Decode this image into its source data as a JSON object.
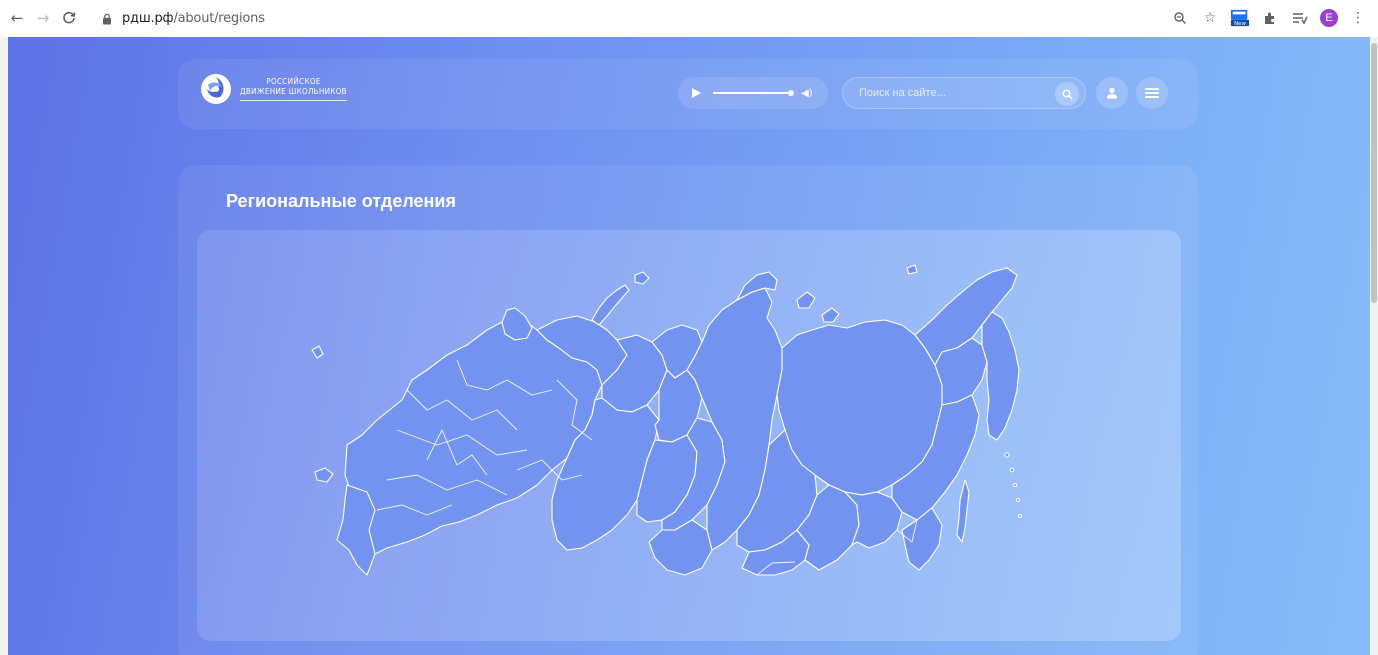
{
  "browser": {
    "url_domain": "рдш.рф",
    "url_path": "/about/regions",
    "profile_initial": "E",
    "extension_badge": "New"
  },
  "header": {
    "logo_line1": "РОССИЙСКОЕ",
    "logo_line2": "ДВИЖЕНИЕ ШКОЛЬНИКОВ",
    "search_placeholder": "Поиск на сайте..."
  },
  "main": {
    "title": "Региональные отделения",
    "map_name": "regions-map"
  },
  "colors": {
    "gradient_start": "#5d72e6",
    "gradient_end": "#86bdf9",
    "map_fill": "#6f8ff0",
    "map_stroke": "#ffffff"
  }
}
